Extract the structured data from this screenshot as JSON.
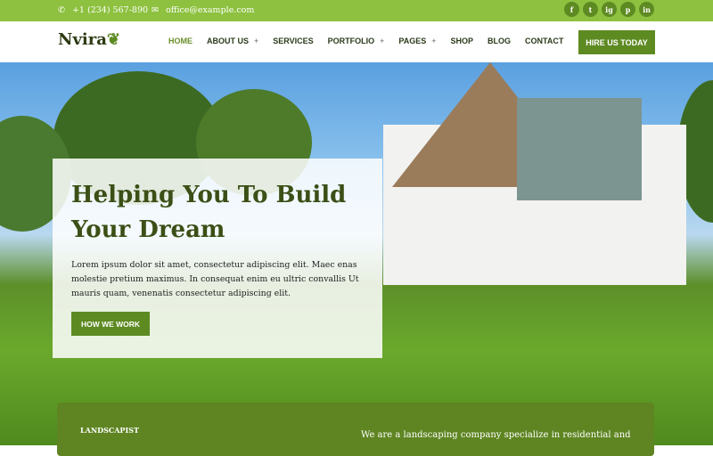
{
  "topbar": {
    "phone": "+1 (234) 567-890",
    "email": "office@example.com",
    "social": [
      "f",
      "t",
      "ig",
      "p",
      "in"
    ]
  },
  "header": {
    "logo": "Nvira",
    "nav": [
      {
        "label": "HOME",
        "active": true
      },
      {
        "label": "ABOUT US",
        "plus": "+"
      },
      {
        "label": "SERVICES"
      },
      {
        "label": "PORTFOLIO",
        "plus": "+"
      },
      {
        "label": "PAGES",
        "plus": "+"
      },
      {
        "label": "SHOP"
      },
      {
        "label": "BLOG"
      },
      {
        "label": "CONTACT"
      }
    ],
    "cta": "HIRE US TODAY"
  },
  "hero": {
    "title": "Helping You To Build Your Dream",
    "text": "Lorem ipsum dolor sit amet, consectetur adipiscing elit. Maec enas molestie pretium maximus. In consequat enim eu ultric convallis Ut mauris quam, venenatis consectetur adipiscing elit.",
    "button": "HOW WE WORK"
  },
  "band": {
    "label": "LANDSCAPIST",
    "text": "We are a landscaping company specialize in residential and"
  },
  "colors": {
    "accent": "#8dc13f",
    "dark_green": "#5e8a22"
  }
}
